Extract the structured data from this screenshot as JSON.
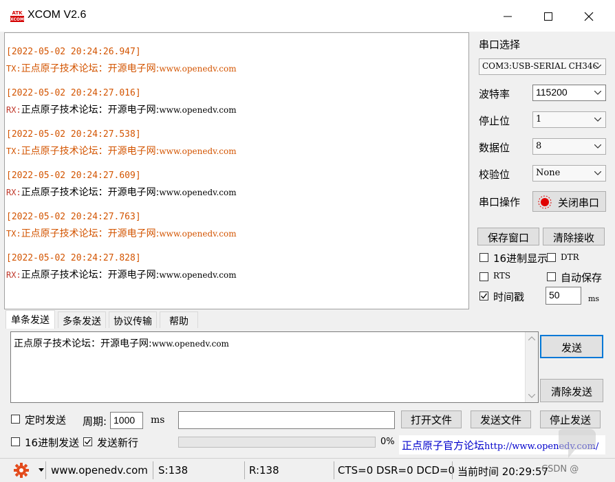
{
  "titlebar": {
    "logo_text_top": "ATK",
    "logo_text_bottom": "XCOM",
    "title": "XCOM V2.6",
    "icons": [
      "minimize-icon",
      "maximize-icon",
      "close-icon"
    ]
  },
  "receive_log": [
    {
      "time": "[2022-05-02 20:24:26.947]",
      "dir": "TX",
      "prefix": "TX:",
      "text": "正点原子技术论坛：开源电子网:",
      "url": "www.openedv.com"
    },
    {
      "time": "[2022-05-02 20:24:27.016]",
      "dir": "RX",
      "prefix": "RX:",
      "text": "正点原子技术论坛：开源电子网:",
      "url": "www.openedv.com"
    },
    {
      "time": "[2022-05-02 20:24:27.538]",
      "dir": "TX",
      "prefix": "TX:",
      "text": "正点原子技术论坛：开源电子网:",
      "url": "www.openedv.com"
    },
    {
      "time": "[2022-05-02 20:24:27.609]",
      "dir": "RX",
      "prefix": "RX:",
      "text": "正点原子技术论坛：开源电子网:",
      "url": "www.openedv.com"
    },
    {
      "time": "[2022-05-02 20:24:27.763]",
      "dir": "TX",
      "prefix": "TX:",
      "text": "正点原子技术论坛：开源电子网:",
      "url": "www.openedv.com"
    },
    {
      "time": "[2022-05-02 20:24:27.828]",
      "dir": "RX",
      "prefix": "RX:",
      "text": "正点原子技术论坛：开源电子网:",
      "url": "www.openedv.com"
    }
  ],
  "serial": {
    "port_label": "串口选择",
    "port_value": "COM3:USB-SERIAL CH34C",
    "baud_label": "波特率",
    "baud_value": "115200",
    "stop_label": "停止位",
    "stop_value": "1",
    "data_label": "数据位",
    "data_value": "8",
    "parity_label": "校验位",
    "parity_value": "None",
    "op_label": "串口操作",
    "close_port_label": "关闭串口",
    "status_color": "#e00000"
  },
  "rx_options": {
    "save_window": "保存窗口",
    "clear_receive": "清除接收",
    "hex_display": {
      "label": "16进制显示",
      "checked": false
    },
    "dtr": {
      "label": "DTR",
      "checked": false
    },
    "rts": {
      "label": "RTS",
      "checked": false
    },
    "auto_save": {
      "label": "自动保存",
      "checked": false
    },
    "timestamp": {
      "label": "时间戳",
      "checked": true
    },
    "timestamp_value": "50",
    "timestamp_unit": "ms"
  },
  "tabs": [
    {
      "label": "单条发送",
      "active": true
    },
    {
      "label": "多条发送",
      "active": false
    },
    {
      "label": "协议传输",
      "active": false
    },
    {
      "label": "帮助",
      "active": false
    }
  ],
  "send": {
    "text": "正点原子技术论坛：开源电子网:",
    "url": "www.openedv.com",
    "send_button": "发送",
    "clear_send_button": "清除发送"
  },
  "send_options": {
    "timed_send": {
      "label": "定时发送",
      "checked": false
    },
    "period_label": "周期:",
    "period_value": "1000",
    "period_unit": "ms",
    "hex_send": {
      "label": "16进制发送",
      "checked": false
    },
    "send_newline": {
      "label": "发送新行",
      "checked": true
    },
    "open_file": "打开文件",
    "send_file": "发送文件",
    "stop_send": "停止发送",
    "progress_text": "0%",
    "progress": 0,
    "forum_text": "正点原子官方论坛",
    "forum_url": "http://www.openedv.com/"
  },
  "statusbar": {
    "website": "www.openedv.com",
    "sent": "S:138",
    "received": "R:138",
    "signals": "CTS=0 DSR=0 DCD=0",
    "time": "当前时间 20:29:57"
  },
  "watermark": {
    "text": "CSDN @"
  },
  "colors": {
    "tx_text": "#d35400",
    "accent": "#0078d7"
  }
}
